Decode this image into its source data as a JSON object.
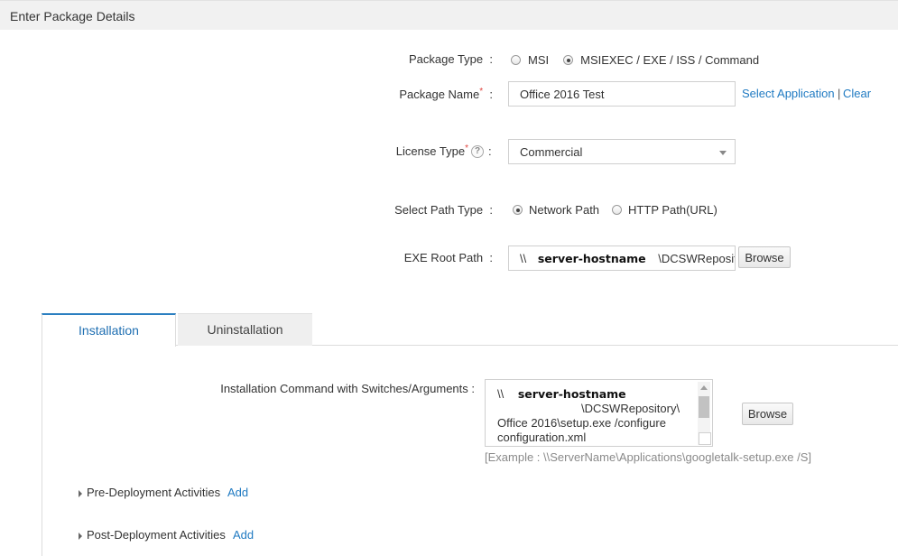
{
  "section": {
    "title": "Enter Package Details"
  },
  "package_type": {
    "label": "Package Type",
    "colon": ":",
    "options": [
      {
        "label": "MSI",
        "checked": false
      },
      {
        "label": "MSIEXEC / EXE / ISS / Command",
        "checked": true
      }
    ]
  },
  "package_name": {
    "label": "Package Name",
    "required_mark": "*",
    "colon": ":",
    "value": "Office 2016 Test",
    "select_app_link": "Select Application",
    "separator": "|",
    "clear_link": "Clear"
  },
  "license_type": {
    "label": "License Type",
    "required_mark": "*",
    "help_icon": "?",
    "colon": ":",
    "value": "Commercial"
  },
  "path_type": {
    "label": "Select Path Type",
    "colon": ":",
    "options": [
      {
        "label": "Network Path",
        "checked": true
      },
      {
        "label": "HTTP Path(URL)",
        "checked": false
      }
    ]
  },
  "exe_root": {
    "label": "EXE Root Path",
    "colon": ":",
    "prefix": "\\\\",
    "host": "server-hostname",
    "suffix": "\\DCSWRepositor",
    "browse": "Browse"
  },
  "tabs": [
    {
      "label": "Installation",
      "active": true
    },
    {
      "label": "Uninstallation",
      "active": false
    }
  ],
  "install": {
    "label": "Installation Command with Switches/Arguments :",
    "cmd_prefix": "\\\\",
    "cmd_host": "server-hostname",
    "cmd_line2": "\\DCSWRepository\\",
    "cmd_line3": "Office 2016\\setup.exe /configure",
    "cmd_line4": "configuration.xml",
    "browse": "Browse",
    "example": "[Example : \\\\ServerName\\Applications\\googletalk-setup.exe /S]"
  },
  "pre_deploy": {
    "label": "Pre-Deployment Activities",
    "add": "Add"
  },
  "post_deploy": {
    "label": "Post-Deployment Activities",
    "add": "Add"
  },
  "colors": {
    "link": "#1f7ac2",
    "tab_accent": "#2b7fc1",
    "required": "#e0443e"
  }
}
